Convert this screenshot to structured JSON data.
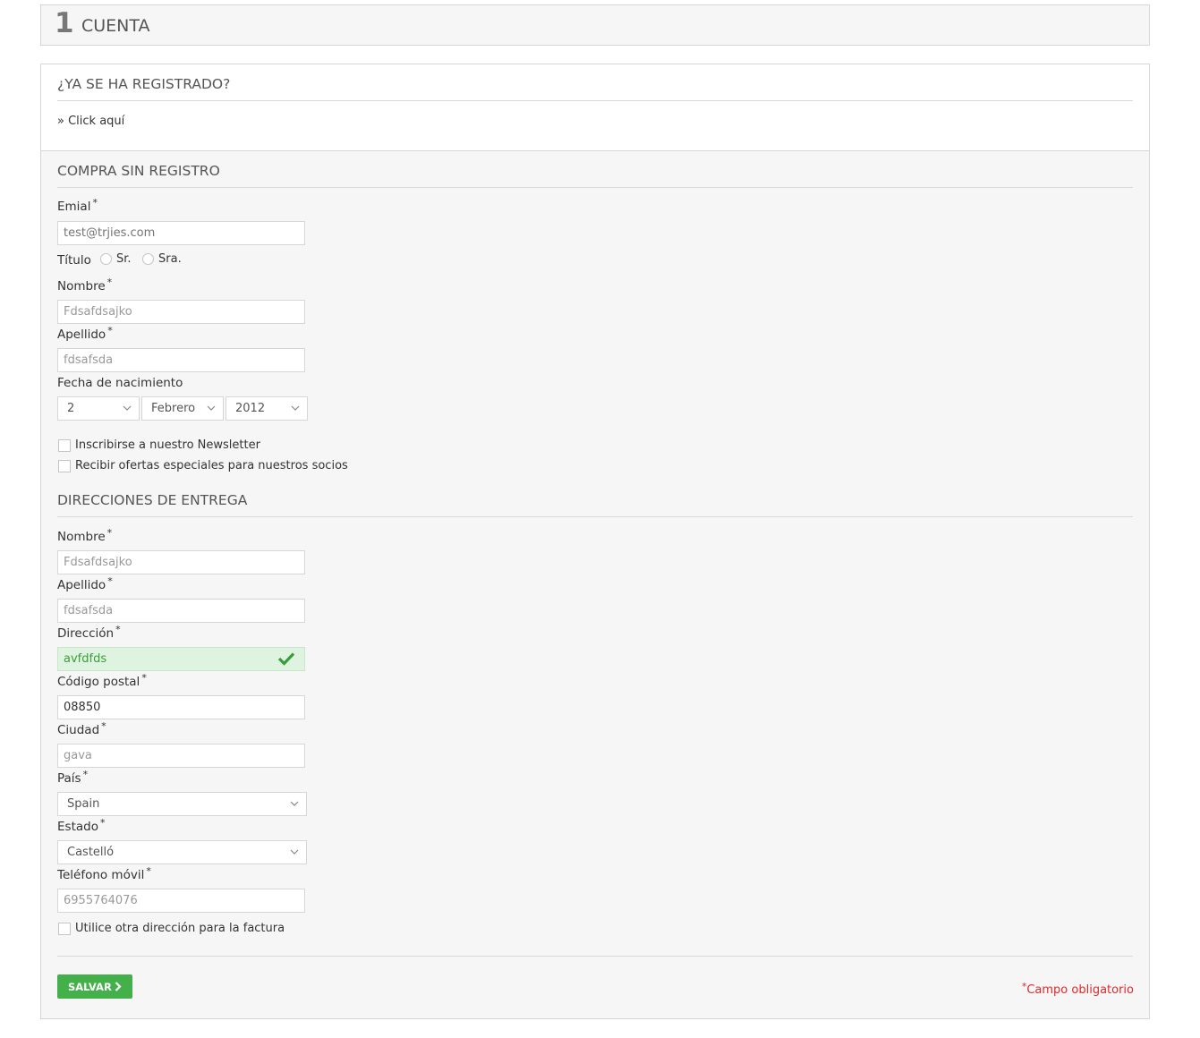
{
  "step": {
    "number": "1",
    "title": "CUENTA"
  },
  "login": {
    "title": "¿YA SE HA REGISTRADO?",
    "link": "» Click aquí"
  },
  "guest": {
    "title": "COMPRA SIN REGISTRO",
    "email": {
      "label": "Emial",
      "placeholder": "test@trjies.com"
    },
    "titulo": {
      "label": "Título",
      "options": [
        "Sr.",
        "Sra."
      ]
    },
    "nombre": {
      "label": "Nombre",
      "value": "Fdsafdsajko"
    },
    "apellido": {
      "label": "Apellido",
      "value": "fdsafsda"
    },
    "fecha": {
      "label": "Fecha de nacimiento",
      "day": "2",
      "month": "Febrero",
      "year": "2012"
    },
    "newsletter": "Inscribirse a nuestro Newsletter",
    "offers": "Recibir ofertas especiales para nuestros socios"
  },
  "delivery": {
    "title": "DIRECCIONES DE ENTREGA",
    "nombre": {
      "label": "Nombre",
      "value": "Fdsafdsajko"
    },
    "apellido": {
      "label": "Apellido",
      "value": "fdsafsda"
    },
    "direccion": {
      "label": "Dirección",
      "value": "avfdfds"
    },
    "codigo": {
      "label": "Código postal",
      "value": "08850"
    },
    "ciudad": {
      "label": "Ciudad",
      "value": "gava"
    },
    "pais": {
      "label": "País",
      "value": "Spain"
    },
    "estado": {
      "label": "Estado",
      "value": "Castelló"
    },
    "telefono": {
      "label": "Teléfono móvil",
      "value": "6955764076"
    },
    "other_address": "Utilice otra dirección para la factura"
  },
  "required_star": "*",
  "actions": {
    "save": "SALVAR",
    "required_note": "Campo obligatorio"
  },
  "colors": {
    "accent": "#43b049",
    "valid_bg": "#dff4e0",
    "required": "#e02a2a"
  },
  "icons": {
    "valid": "check-icon",
    "save": "chevron-right-icon",
    "select": "chevron-down-icon"
  }
}
